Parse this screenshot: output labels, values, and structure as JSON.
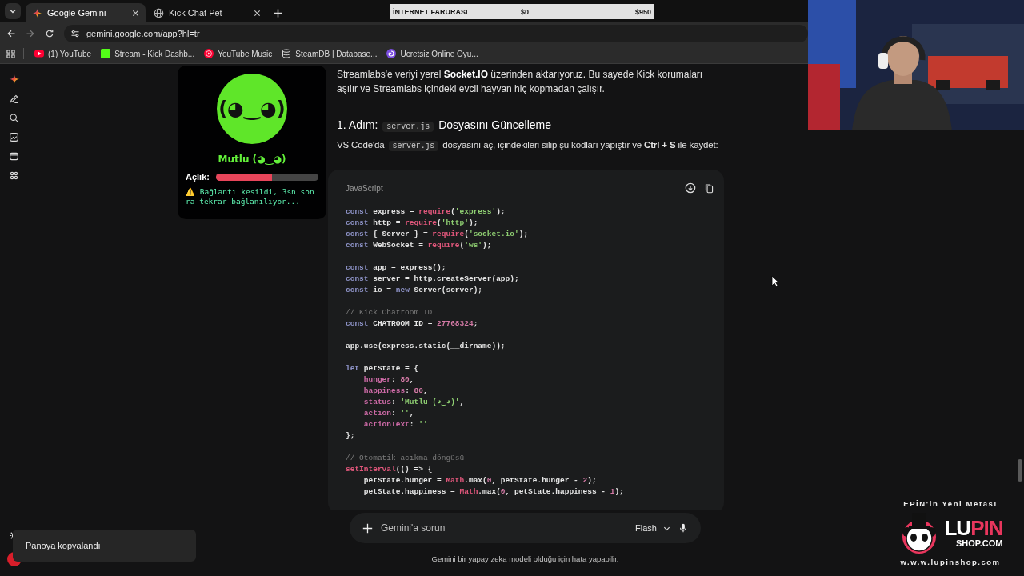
{
  "browser": {
    "tabs": [
      {
        "title": "Google Gemini",
        "kind": "gemini",
        "selected": true
      },
      {
        "title": "Kick Chat Pet",
        "kind": "globe",
        "selected": false
      }
    ],
    "url": "gemini.google.com/app?hl=tr",
    "bookmarks": [
      {
        "label": "(1) YouTube",
        "kind": "youtube"
      },
      {
        "label": "Stream - Kick Dashb...",
        "kind": "kick"
      },
      {
        "label": "YouTube Music",
        "kind": "music"
      },
      {
        "label": "SteamDB | Database...",
        "kind": "database"
      },
      {
        "label": "Ücretsiz Online Oyu...",
        "kind": "swirl"
      }
    ]
  },
  "gemini": {
    "paragraph": "Streamlabs'e veriyi yerel **Socket.IO** üzerinden aktarıyoruz. Bu sayede Kick korumaları aşılır ve Streamlabs içindeki evcil hayvan hiç kopmadan çalışır.",
    "heading": [
      {
        "kind": "text",
        "text": "1. Adım: "
      },
      {
        "kind": "code",
        "text": "server.js"
      },
      {
        "kind": "text",
        "text": " Dosyasını Güncelleme"
      }
    ],
    "instruction": [
      {
        "kind": "text",
        "text": "VS Code'da "
      },
      {
        "kind": "code",
        "text": "server.js"
      },
      {
        "kind": "text",
        "text": " dosyasını aç, içindekileri silip şu kodları yapıştır ve **Ctrl + S** ile kaydet:"
      }
    ],
    "code_block": {
      "language": "JavaScript",
      "lines": [
        {
          "kind": "code",
          "tokens": [
            {
              "kind": "keyword",
              "text": "const"
            },
            {
              "kind": "plain",
              "text": " express = "
            },
            {
              "kind": "call",
              "text": "require"
            },
            {
              "kind": "plain",
              "text": "("
            },
            {
              "kind": "string",
              "text": "'express'"
            },
            {
              "kind": "plain",
              "text": ");"
            }
          ]
        },
        {
          "kind": "code",
          "tokens": [
            {
              "kind": "keyword",
              "text": "const"
            },
            {
              "kind": "plain",
              "text": " http = "
            },
            {
              "kind": "call",
              "text": "require"
            },
            {
              "kind": "plain",
              "text": "("
            },
            {
              "kind": "string",
              "text": "'http'"
            },
            {
              "kind": "plain",
              "text": ");"
            }
          ]
        },
        {
          "kind": "code",
          "tokens": [
            {
              "kind": "keyword",
              "text": "const"
            },
            {
              "kind": "plain",
              "text": " { Server } = "
            },
            {
              "kind": "call",
              "text": "require"
            },
            {
              "kind": "plain",
              "text": "("
            },
            {
              "kind": "string",
              "text": "'socket.io'"
            },
            {
              "kind": "plain",
              "text": ");"
            }
          ]
        },
        {
          "kind": "code",
          "tokens": [
            {
              "kind": "keyword",
              "text": "const"
            },
            {
              "kind": "plain",
              "text": " WebSocket = "
            },
            {
              "kind": "call",
              "text": "require"
            },
            {
              "kind": "plain",
              "text": "("
            },
            {
              "kind": "string",
              "text": "'ws'"
            },
            {
              "kind": "plain",
              "text": ");"
            }
          ]
        },
        {
          "kind": "blank"
        },
        {
          "kind": "code",
          "tokens": [
            {
              "kind": "keyword",
              "text": "const"
            },
            {
              "kind": "plain",
              "text": " app = express();"
            }
          ]
        },
        {
          "kind": "code",
          "tokens": [
            {
              "kind": "keyword",
              "text": "const"
            },
            {
              "kind": "plain",
              "text": " server = http.createServer(app);"
            }
          ]
        },
        {
          "kind": "code",
          "tokens": [
            {
              "kind": "keyword",
              "text": "const"
            },
            {
              "kind": "plain",
              "text": " io = "
            },
            {
              "kind": "keyword",
              "text": "new"
            },
            {
              "kind": "plain",
              "text": " Server(server);"
            }
          ]
        },
        {
          "kind": "blank"
        },
        {
          "kind": "code",
          "tokens": [
            {
              "kind": "comment",
              "text": "// Kick Chatroom ID"
            }
          ]
        },
        {
          "kind": "code",
          "tokens": [
            {
              "kind": "keyword",
              "text": "const"
            },
            {
              "kind": "plain",
              "text": " CHATROOM_ID = "
            },
            {
              "kind": "number",
              "text": "27768324"
            },
            {
              "kind": "plain",
              "text": ";"
            }
          ]
        },
        {
          "kind": "blank"
        },
        {
          "kind": "code",
          "tokens": [
            {
              "kind": "plain",
              "text": "app.use(express.static(__dirname));"
            }
          ]
        },
        {
          "kind": "blank"
        },
        {
          "kind": "code",
          "tokens": [
            {
              "kind": "keyword",
              "text": "let"
            },
            {
              "kind": "plain",
              "text": " petState = {"
            }
          ]
        },
        {
          "kind": "code",
          "tokens": [
            {
              "kind": "property",
              "text": "    hunger"
            },
            {
              "kind": "plain",
              "text": ": "
            },
            {
              "kind": "number",
              "text": "80"
            },
            {
              "kind": "plain",
              "text": ","
            }
          ]
        },
        {
          "kind": "code",
          "tokens": [
            {
              "kind": "property",
              "text": "    happiness"
            },
            {
              "kind": "plain",
              "text": ": "
            },
            {
              "kind": "number",
              "text": "80"
            },
            {
              "kind": "plain",
              "text": ","
            }
          ]
        },
        {
          "kind": "code",
          "tokens": [
            {
              "kind": "property",
              "text": "    status"
            },
            {
              "kind": "plain",
              "text": ": "
            },
            {
              "kind": "string",
              "text": "'Mutlu (◕‿◕)'"
            },
            {
              "kind": "plain",
              "text": ","
            }
          ]
        },
        {
          "kind": "code",
          "tokens": [
            {
              "kind": "property",
              "text": "    action"
            },
            {
              "kind": "plain",
              "text": ": "
            },
            {
              "kind": "string",
              "text": "''"
            },
            {
              "kind": "plain",
              "text": ","
            }
          ]
        },
        {
          "kind": "code",
          "tokens": [
            {
              "kind": "property",
              "text": "    actionText"
            },
            {
              "kind": "plain",
              "text": ": "
            },
            {
              "kind": "string",
              "text": "''"
            }
          ]
        },
        {
          "kind": "code",
          "tokens": [
            {
              "kind": "plain",
              "text": "};"
            }
          ]
        },
        {
          "kind": "blank"
        },
        {
          "kind": "code",
          "tokens": [
            {
              "kind": "comment",
              "text": "// Otomatik acıkma döngüsü"
            }
          ]
        },
        {
          "kind": "code",
          "tokens": [
            {
              "kind": "call",
              "text": "setInterval"
            },
            {
              "kind": "plain",
              "text": "(() => {"
            }
          ]
        },
        {
          "kind": "code",
          "tokens": [
            {
              "kind": "plain",
              "text": "    petState.hunger = "
            },
            {
              "kind": "call",
              "text": "Math"
            },
            {
              "kind": "plain",
              "text": ".max("
            },
            {
              "kind": "number",
              "text": "0"
            },
            {
              "kind": "plain",
              "text": ", petState.hunger - "
            },
            {
              "kind": "number",
              "text": "2"
            },
            {
              "kind": "plain",
              "text": ");"
            }
          ]
        },
        {
          "kind": "code",
          "tokens": [
            {
              "kind": "plain",
              "text": "    petState.happiness = "
            },
            {
              "kind": "call",
              "text": "Math"
            },
            {
              "kind": "plain",
              "text": ".max("
            },
            {
              "kind": "number",
              "text": "0"
            },
            {
              "kind": "plain",
              "text": ", petState.happiness - "
            },
            {
              "kind": "number",
              "text": "1"
            },
            {
              "kind": "plain",
              "text": ");"
            }
          ]
        }
      ]
    },
    "prompt": {
      "placeholder": "Gemini'a sorun",
      "model": "Flash"
    },
    "disclaimer": "Gemini bir yapay zeka modeli olduğu için hata yapabilir.",
    "toast": "Panoya kopyalandı"
  },
  "pet_overlay": {
    "face": "(◕‿◕)",
    "status": "Mutlu (◕‿◕)",
    "hunger": {
      "label": "Açlık:",
      "level": 0.55
    },
    "warning": "⚠️ Bağlantı kesildi, 3sn sonra tekrar bağlanılıyor..."
  },
  "donation_goal": {
    "title": "İNTERNET FARURASI",
    "current": "$0",
    "target": "$950",
    "level": 0
  },
  "sponsor": {
    "tagline": "EPİN'in Yeni Metası",
    "logo_parts": [
      "LU",
      "PIN"
    ],
    "logo_sub": "SHOP.COM",
    "url": "w.w.w.lupinshop.com"
  }
}
